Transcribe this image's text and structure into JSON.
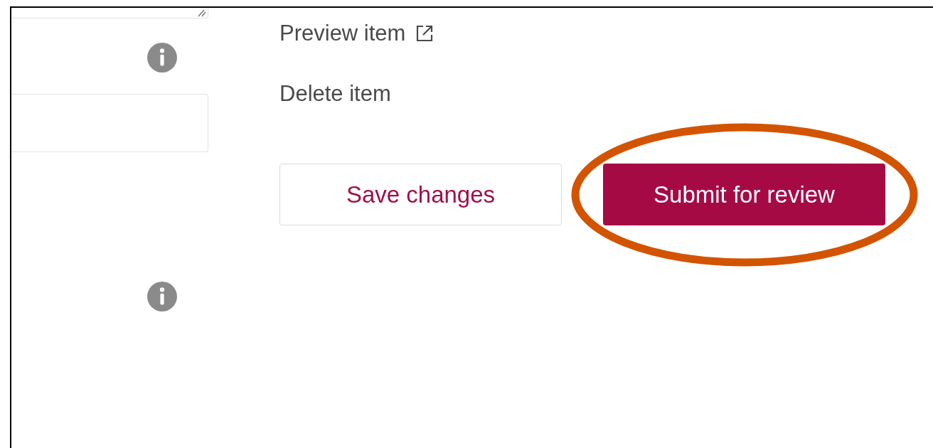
{
  "links": [
    {
      "label": "Preview item",
      "kind": "external"
    },
    {
      "label": "Delete item",
      "kind": "plain"
    }
  ],
  "buttons": [
    {
      "label": "Save changes",
      "kind": "secondary",
      "highlighted": false
    },
    {
      "label": "Submit for review",
      "kind": "primary",
      "highlighted": true
    }
  ]
}
